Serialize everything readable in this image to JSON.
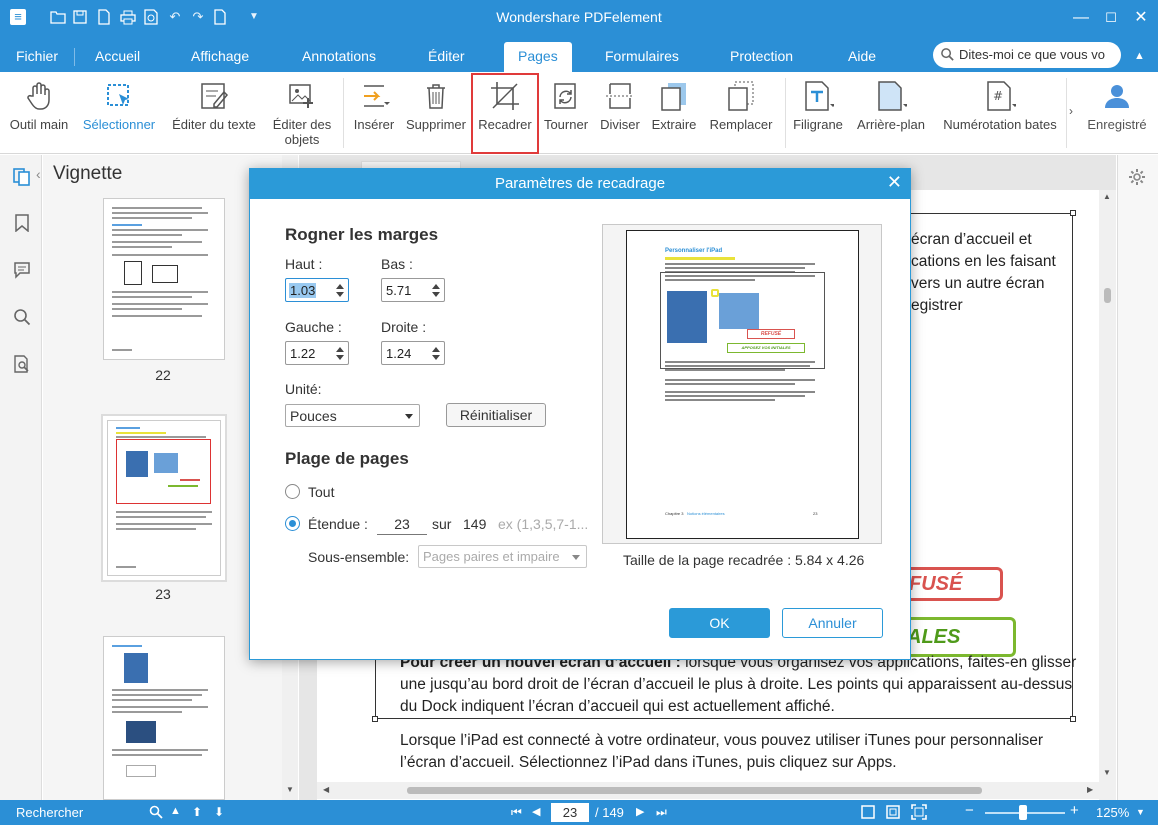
{
  "window": {
    "title": "Wondershare PDFelement"
  },
  "quick_access": [
    "menu-icon",
    "folder-icon",
    "save-icon",
    "file-icon",
    "print-icon",
    "preview-icon",
    "undo-icon",
    "redo-icon",
    "page-icon",
    "dropdown-icon"
  ],
  "tabs": [
    {
      "label": "Fichier"
    },
    {
      "label": "Accueil"
    },
    {
      "label": "Affichage"
    },
    {
      "label": "Annotations"
    },
    {
      "label": "Éditer"
    },
    {
      "label": "Pages",
      "active": true
    },
    {
      "label": "Formulaires"
    },
    {
      "label": "Protection"
    },
    {
      "label": "Aide"
    }
  ],
  "search": {
    "placeholder": "Dites-moi ce que vous vo"
  },
  "ribbon": [
    {
      "label": "Outil main",
      "icon": "hand-icon"
    },
    {
      "label": "Sélectionner",
      "icon": "select-arrow-icon",
      "active": true
    },
    {
      "label": "Éditer du texte",
      "icon": "edit-text-icon"
    },
    {
      "label": "Éditer des objets",
      "icon": "edit-objects-icon"
    },
    {
      "label": "Insérer",
      "icon": "insert-page-icon"
    },
    {
      "label": "Supprimer",
      "icon": "trash-icon"
    },
    {
      "label": "Recadrer",
      "icon": "crop-icon"
    },
    {
      "label": "Tourner",
      "icon": "rotate-icon"
    },
    {
      "label": "Diviser",
      "icon": "split-icon"
    },
    {
      "label": "Extraire",
      "icon": "extract-icon"
    },
    {
      "label": "Remplacer",
      "icon": "replace-icon"
    },
    {
      "label": "Filigrane",
      "icon": "watermark-icon"
    },
    {
      "label": "Arrière-plan",
      "icon": "background-icon"
    },
    {
      "label": "Numérotation bates",
      "icon": "bates-number-icon"
    },
    {
      "label": "Enregistré",
      "icon": "user-icon"
    }
  ],
  "thumbnails": {
    "title": "Vignette",
    "pages": [
      "22",
      "23"
    ]
  },
  "document": {
    "right_fragments": [
      "écran d’accueil et",
      "cations en les faisant",
      "vers un autre écran",
      "egistrer"
    ],
    "stamp_refuse": "FUSÉ",
    "stamp_initiales": "ALES",
    "para1_bold": "Pour créer un nouvel écran d’accueil :",
    "para1_line1_rest": " lorsque vous organisez vos applications, faites-en glisser",
    "para1_line2": "une jusqu’au bord droit de l’écran d’accueil le plus à droite. Les points qui apparaissent au-dessus",
    "para1_line3": "du Dock indiquent l’écran d’accueil qui est actuellement affiché.",
    "para2_line1": "Lorsque l’iPad est connecté à votre ordinateur, vous pouvez utiliser iTunes pour personnaliser",
    "para2_line2": "l’écran d’accueil. Sélectionnez l’iPad dans iTunes, puis cliquez sur Apps."
  },
  "dialog": {
    "title": "Paramètres de recadrage",
    "margins_heading": "Rogner les marges",
    "top_label": "Haut :",
    "top_value": "1.03",
    "bottom_label": "Bas :",
    "bottom_value": "5.71",
    "left_label": "Gauche :",
    "left_value": "1.22",
    "right_label": "Droite :",
    "right_value": "1.24",
    "unit_label": "Unité:",
    "unit_value": "Pouces",
    "reset_label": "Réinitialiser",
    "range_heading": "Plage de pages",
    "all_label": "Tout",
    "range_label": "Étendue :",
    "range_from": "23",
    "range_sur": "sur",
    "range_total": "149",
    "range_hint": "ex (1,3,5,7-1...",
    "subset_label": "Sous-ensemble:",
    "subset_value": "Pages paires et impaire",
    "preview_size": "Taille de la page recadrée : 5.84 x 4.26",
    "preview_heading": "Personnaliser l'iPad",
    "preview_stamp_refuse": "REFUSÉ",
    "preview_stamp_initiales": "APPOSEZ VOS INITIALES",
    "preview_footer_left": "Chapitre 3",
    "preview_footer_mid": "Notions élémentaires",
    "preview_footer_right": "23",
    "ok_label": "OK",
    "cancel_label": "Annuler"
  },
  "statusbar": {
    "search_label": "Rechercher",
    "page_current": "23",
    "page_total": "/ 149",
    "zoom": "125%",
    "zoom_level": 0.48
  },
  "colors": {
    "accent": "#2b8fd6",
    "dialog_header": "#2b9ad8",
    "highlight": "#e03a3a",
    "stamp_red": "#d9534f",
    "stamp_green": "#7cb82f"
  }
}
